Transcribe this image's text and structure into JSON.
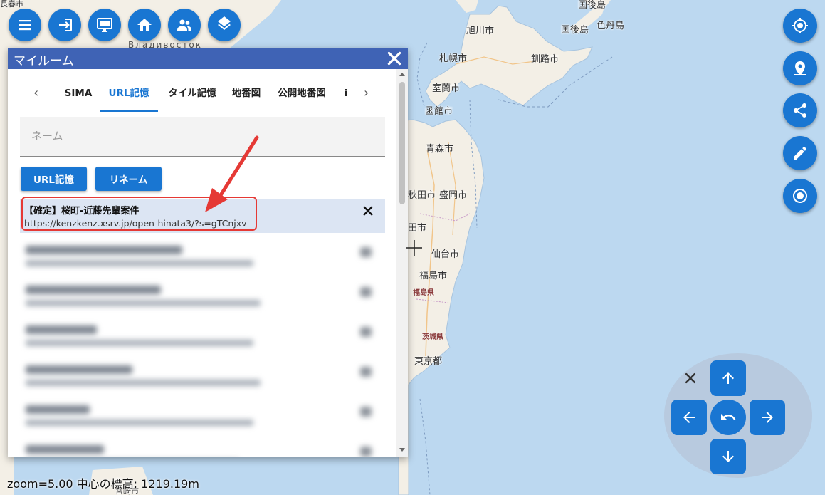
{
  "map": {
    "labels": {
      "asahikawa": "旭川市",
      "sapporo": "札幌市",
      "kushiro": "釧路市",
      "kunashiri": "国後島",
      "shikotan": "色丹島",
      "muroran": "室蘭市",
      "hakodate": "函館市",
      "aomori": "青森市",
      "akita": "秋田市",
      "morioka": "盛岡市",
      "sendai": "仙台市",
      "fukushima": "福島市",
      "tokyo": "東京都",
      "yamagata": "田市",
      "miyazaki": "宮崎市",
      "top_island": "国後島",
      "nagaharu": "長春市"
    },
    "prefectures": {
      "fukushima": "福島県",
      "ibaraki": "茨城県"
    },
    "foreign": {
      "vladivostok": "Владивосток"
    }
  },
  "toolbar": {
    "icons": [
      "menu-icon",
      "login-icon",
      "monitor-icon",
      "home-icon",
      "users-icon",
      "layers-icon"
    ]
  },
  "sidebar": {
    "icons": [
      "crosshair-target-icon",
      "location-pin-icon",
      "share-icon",
      "edit-pencil-icon",
      "radio-target-icon"
    ]
  },
  "dialog": {
    "title": "マイルーム",
    "tabs": {
      "prev": "‹",
      "next": "›",
      "items": [
        "SIMA",
        "URL記憶",
        "タイル記憶",
        "地番図",
        "公開地番図",
        "i"
      ],
      "active_index": 1
    },
    "name_placeholder": "ネーム",
    "buttons": {
      "save_url": "URL記憶",
      "rename": "リネーム"
    },
    "entries": [
      {
        "title": "【確定】桜町-近藤先輩案件",
        "url": "https://kenzkenz.xsrv.jp/open-hinata3/?s=gTCnjxv"
      }
    ]
  },
  "status": {
    "text": "zoom=5.00 中心の標高: 1219.19m"
  },
  "colors": {
    "primary": "#1976d2",
    "dialog_header": "#3f63b5",
    "sea": "#bcd8f0",
    "land": "#f3efe6",
    "highlight": "#e53935"
  }
}
